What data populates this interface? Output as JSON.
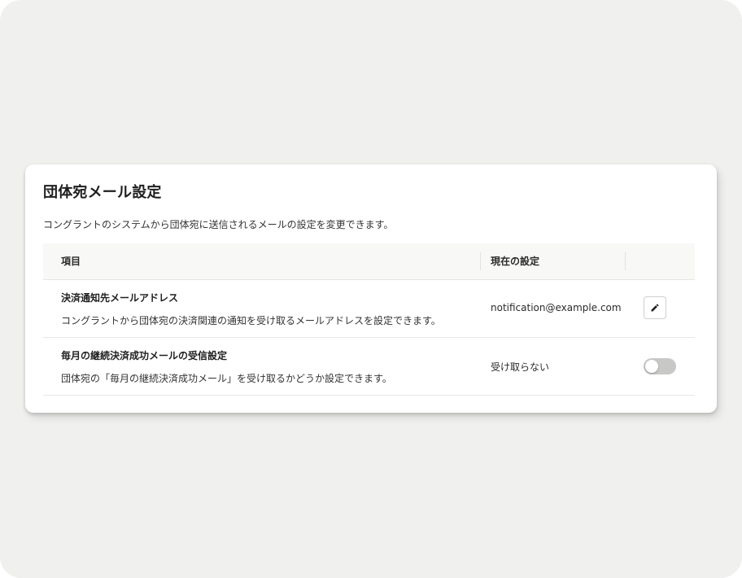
{
  "settings_card": {
    "title": "団体宛メール設定",
    "description": "コングラントのシステムから団体宛に送信されるメールの設定を変更できます。"
  },
  "table": {
    "headers": {
      "item": "項目",
      "current_setting": "現在の設定"
    },
    "rows": [
      {
        "title": "決済通知先メールアドレス",
        "description": "コングラントから団体宛の決済関連の通知を受け取るメールアドレスを設定できます。",
        "value": "notification@example.com",
        "action_icon": "pencil-icon"
      },
      {
        "title": "毎月の継続決済成功メールの受信設定",
        "description": "団体宛の「毎月の継続決済成功メール」を受け取るかどうか設定できます。",
        "value": "受け取らない",
        "toggle_on": false
      }
    ]
  },
  "colors": {
    "background": "#f0f0ef",
    "card": "#ffffff",
    "header_row": "#f8f8f6",
    "toggle_off": "#c8c8c6",
    "text": "#222222"
  }
}
